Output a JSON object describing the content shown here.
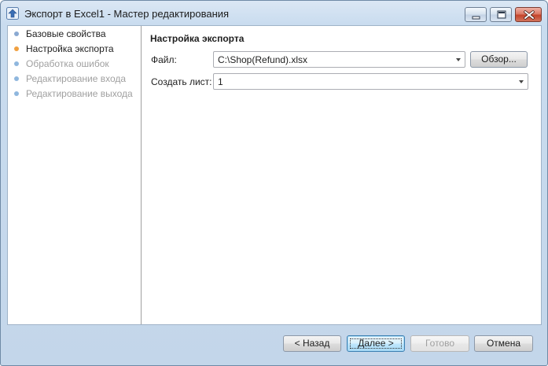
{
  "window": {
    "title": "Экспорт в Excel1 - Мастер редактирования"
  },
  "steps": [
    {
      "label": "Базовые свойства",
      "state": "done"
    },
    {
      "label": "Настройка экспорта",
      "state": "active"
    },
    {
      "label": "Обработка ошибок",
      "state": "pending"
    },
    {
      "label": "Редактирование входа",
      "state": "pending"
    },
    {
      "label": "Редактирование выхода",
      "state": "pending"
    }
  ],
  "content": {
    "section_title": "Настройка экспорта",
    "file": {
      "label": "Файл:",
      "value": "C:\\Shop(Refund).xlsx",
      "browse_label": "Обзор..."
    },
    "sheet": {
      "label": "Создать лист:",
      "value": "1"
    }
  },
  "footer": {
    "back_label": "< Назад",
    "next_label": "Далее >",
    "finish_label": "Готово",
    "cancel_label": "Отмена"
  },
  "colors": {
    "active_step_dot": "#f0a040",
    "done_step_dot": "#8aa9d2",
    "pending_step_dot": "#8fb7de",
    "pending_step_text": "#a0a0a0",
    "close_button": "#c4442b"
  }
}
